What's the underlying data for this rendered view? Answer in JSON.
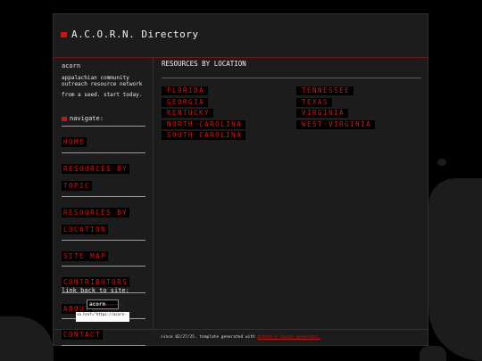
{
  "header": {
    "title": "A.C.O.R.N. Directory"
  },
  "sidebar": {
    "site_name": "acorn",
    "description": "appalachian community outreach resource network",
    "tagline": "from a seed. start today.",
    "nav_heading": "navigate:",
    "nav_items": [
      {
        "label": "HOME"
      },
      {
        "label": "RESOURCES BY TOPIC"
      },
      {
        "label": "RESOURCES BY LOCATION"
      },
      {
        "label": "SITE MAP"
      },
      {
        "label": "CONTRIBUTORS"
      },
      {
        "label": "ABOUT"
      },
      {
        "label": "CONTACT"
      }
    ],
    "link_back_heading": "link back to site:",
    "badge": {
      "text": "acorn",
      "sub": "directory"
    },
    "code_snippet": "<a href=\"https://acorn-"
  },
  "main": {
    "heading": "RESOURCES BY LOCATION",
    "states_col1": [
      "FLORIDA",
      "GEORGIA",
      "KENTUCKY",
      "NORTH CAROLINA",
      "SOUTH CAROLINA"
    ],
    "states_col2": [
      "TENNESSEE",
      "TEXAS",
      "VIRGINIA",
      "WEST VIRGINIA"
    ]
  },
  "footer": {
    "text": "since 02/27/25. template generated with",
    "link": "Kitteh's layout generator."
  },
  "colors": {
    "accent": "#c01818",
    "background": "#000000",
    "panel": "#1c1c1c",
    "border": "#6a1a1a"
  }
}
